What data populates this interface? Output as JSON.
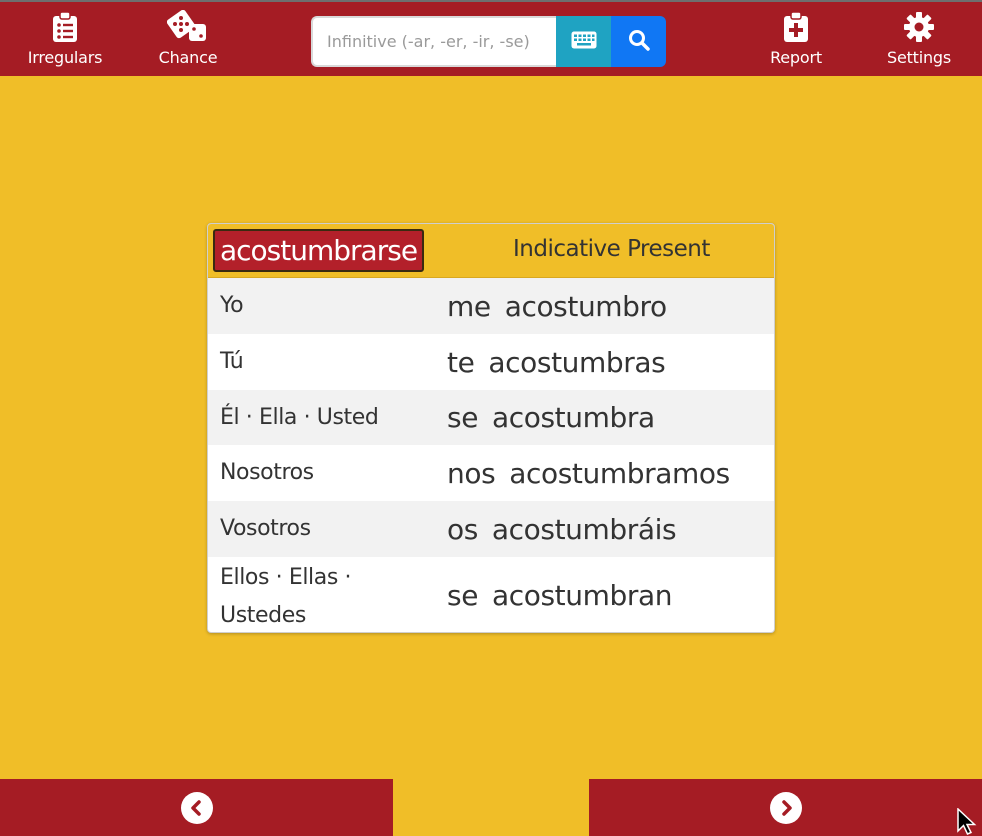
{
  "header": {
    "nav_left": [
      {
        "label": "Irregulars",
        "icon": "clipboard-list-icon"
      },
      {
        "label": "Chance",
        "icon": "dice-icon"
      }
    ],
    "nav_right": [
      {
        "label": "Report",
        "icon": "clipboard-plus-icon"
      },
      {
        "label": "Settings",
        "icon": "gear-icon"
      }
    ],
    "search": {
      "placeholder": "Infinitive (-ar, -er, -ir, -se)",
      "value": ""
    }
  },
  "card": {
    "verb": "acostumbrarse",
    "tense": "Indicative Present",
    "rows": [
      {
        "pronoun": "Yo",
        "reflexive": "me",
        "form": "acostumbro"
      },
      {
        "pronoun": "Tú",
        "reflexive": "te",
        "form": "acostumbras"
      },
      {
        "pronoun": "Él · Ella · Usted",
        "reflexive": "se",
        "form": "acostumbra"
      },
      {
        "pronoun": "Nosotros",
        "reflexive": "nos",
        "form": "acostumbramos"
      },
      {
        "pronoun": "Vosotros",
        "reflexive": "os",
        "form": "acostumbráis"
      },
      {
        "pronoun_line1": "Ellos · Ellas ·",
        "pronoun_line2": "Ustedes",
        "reflexive": "se",
        "form": "acostumbran"
      }
    ]
  },
  "footer": {
    "prev_icon": "chevron-left-circle-icon",
    "next_icon": "chevron-right-circle-icon"
  },
  "colors": {
    "brand_red": "#a51c24",
    "background_yellow": "#f0be28",
    "keyboard_button": "#1fa3c2",
    "search_button": "#1077f4"
  }
}
